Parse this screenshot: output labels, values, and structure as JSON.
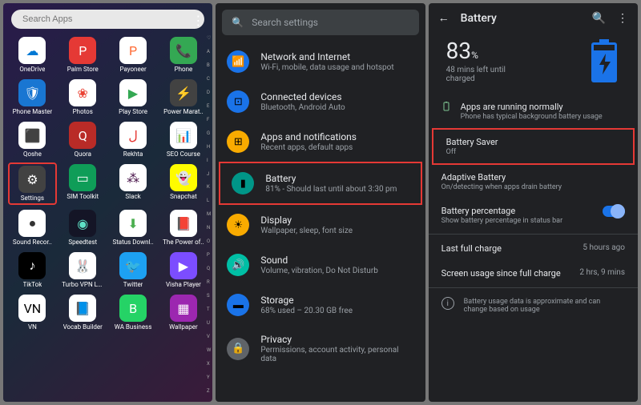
{
  "panel1": {
    "search_placeholder": "Search Apps",
    "alpha": [
      "♡",
      "A",
      "B",
      "C",
      "D",
      "E",
      "F",
      "G",
      "H",
      "I",
      "J",
      "K",
      "L",
      "M",
      "N",
      "O",
      "P",
      "Q",
      "R",
      "S",
      "T",
      "U",
      "V",
      "W",
      "X",
      "Y",
      "Z"
    ],
    "apps": [
      {
        "label": "OneDrive",
        "bg": "#fff",
        "icon": "☁",
        "fg": "#0078d4"
      },
      {
        "label": "Palm Store",
        "bg": "#e53935",
        "icon": "P",
        "fg": "#fff"
      },
      {
        "label": "Payoneer",
        "bg": "#fff",
        "icon": "P",
        "fg": "#ff6b35"
      },
      {
        "label": "Phone",
        "bg": "#34a853",
        "icon": "📞",
        "fg": "#fff"
      },
      {
        "label": "Phone Master",
        "bg": "#1976d2",
        "icon": "🛡",
        "fg": "#fff"
      },
      {
        "label": "Photos",
        "bg": "#fff",
        "icon": "❀",
        "fg": "#ea4335"
      },
      {
        "label": "Play Store",
        "bg": "#fff",
        "icon": "▶",
        "fg": "#34a853"
      },
      {
        "label": "Power Marat..",
        "bg": "#424242",
        "icon": "⚡",
        "fg": "#4caf50"
      },
      {
        "label": "Qoshe",
        "bg": "#fff",
        "icon": "⬛",
        "fg": "#000"
      },
      {
        "label": "Quora",
        "bg": "#b92b27",
        "icon": "Q",
        "fg": "#fff"
      },
      {
        "label": "Rekhta",
        "bg": "#fff",
        "icon": "ل",
        "fg": "#e53935"
      },
      {
        "label": "SEO Course",
        "bg": "#fff",
        "icon": "📊",
        "fg": "#4285f4"
      },
      {
        "label": "Settings",
        "bg": "#424242",
        "icon": "⚙",
        "fg": "#fff",
        "highlight": true
      },
      {
        "label": "SIM Toolkit",
        "bg": "#0f9d58",
        "icon": "▭",
        "fg": "#fff"
      },
      {
        "label": "Slack",
        "bg": "#fff",
        "icon": "⁂",
        "fg": "#4a154b"
      },
      {
        "label": "Snapchat",
        "bg": "#fffc00",
        "icon": "👻",
        "fg": "#fff"
      },
      {
        "label": "Sound Recor..",
        "bg": "#fff",
        "icon": "●",
        "fg": "#333"
      },
      {
        "label": "Speedtest",
        "bg": "#141526",
        "icon": "◉",
        "fg": "#5ee0c5"
      },
      {
        "label": "Status Downl..",
        "bg": "#fff",
        "icon": "⬇",
        "fg": "#4caf50"
      },
      {
        "label": "The Power of..",
        "bg": "#fff",
        "icon": "📕",
        "fg": "#d32f2f"
      },
      {
        "label": "TikTok",
        "bg": "#000",
        "icon": "♪",
        "fg": "#fff"
      },
      {
        "label": "Turbo VPN Lite",
        "bg": "#fff",
        "icon": "🐰",
        "fg": "#ff9800"
      },
      {
        "label": "Twitter",
        "bg": "#1da1f2",
        "icon": "🐦",
        "fg": "#fff"
      },
      {
        "label": "Visha Player",
        "bg": "#7c4dff",
        "icon": "▶",
        "fg": "#fff"
      },
      {
        "label": "VN",
        "bg": "#fff",
        "icon": "VN",
        "fg": "#000"
      },
      {
        "label": "Vocab Builder",
        "bg": "#fff",
        "icon": "📘",
        "fg": "#00bcd4"
      },
      {
        "label": "WA Business",
        "bg": "#25d366",
        "icon": "B",
        "fg": "#fff"
      },
      {
        "label": "Wallpaper",
        "bg": "#9c27b0",
        "icon": "▦",
        "fg": "#fff"
      }
    ]
  },
  "panel2": {
    "search_placeholder": "Search settings",
    "items": [
      {
        "title": "Network and Internet",
        "sub": "Wi-Fi, mobile, data usage and hotspot",
        "bg": "#1a73e8",
        "icon": "📶"
      },
      {
        "title": "Connected devices",
        "sub": "Bluetooth, Android Auto",
        "bg": "#1a73e8",
        "icon": "⊡"
      },
      {
        "title": "Apps and notifications",
        "sub": "Recent apps, default apps",
        "bg": "#f9ab00",
        "icon": "⊞"
      },
      {
        "title": "Battery",
        "sub": "81% - Should last until about 3:30 pm",
        "bg": "#009688",
        "icon": "▮",
        "highlight": true
      },
      {
        "title": "Display",
        "sub": "Wallpaper, sleep, font size",
        "bg": "#f9ab00",
        "icon": "☀"
      },
      {
        "title": "Sound",
        "sub": "Volume, vibration, Do Not Disturb",
        "bg": "#00bfa5",
        "icon": "🔊"
      },
      {
        "title": "Storage",
        "sub": "68% used – 20.30 GB free",
        "bg": "#1a73e8",
        "icon": "▬"
      },
      {
        "title": "Privacy",
        "sub": "Permissions, account activity, personal data",
        "bg": "#5f6368",
        "icon": "🔒"
      }
    ]
  },
  "panel3": {
    "title": "Battery",
    "percent": "83",
    "percent_unit": "%",
    "remaining": "48 mins left until charged",
    "running_title": "Apps are running normally",
    "running_sub": "Phone has typical background battery usage",
    "saver_title": "Battery Saver",
    "saver_value": "Off",
    "adaptive_title": "Adaptive Battery",
    "adaptive_sub": "On/detecting when apps drain battery",
    "pct_title": "Battery percentage",
    "pct_sub": "Show battery percentage in status bar",
    "last_charge_title": "Last full charge",
    "last_charge_value": "5 hours ago",
    "screen_title": "Screen usage since full charge",
    "screen_value": "2 hrs, 9 mins",
    "footer": "Battery usage data is approximate and can change based on usage"
  }
}
